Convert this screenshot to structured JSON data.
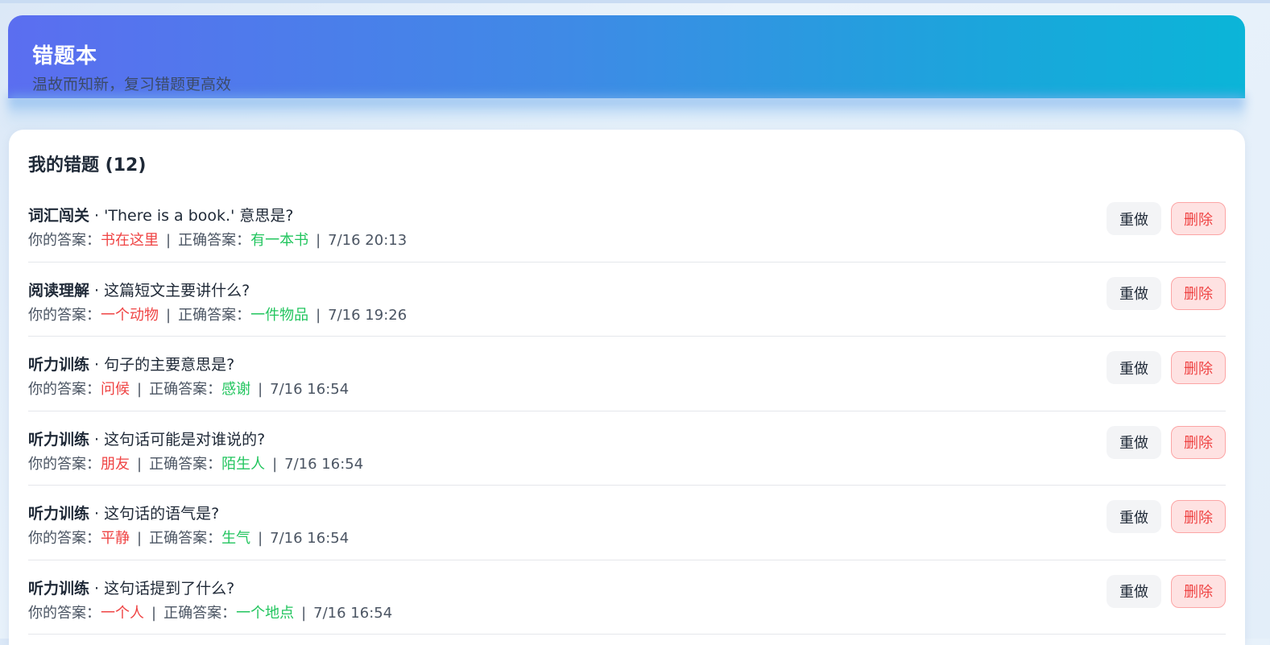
{
  "header": {
    "title": "错题本",
    "subtitle": "温故而知新，复习错题更高效"
  },
  "card": {
    "title": "我的错题 (12)"
  },
  "labels": {
    "your_answer": "你的答案：",
    "correct_answer": "正确答案：",
    "redo": "重做",
    "delete": "删除",
    "dot": " · ",
    "sep": "|"
  },
  "colors": {
    "wrong": "#ef4444",
    "right": "#22c55e",
    "header_start": "#5b6ef0",
    "header_end": "#0bb5d8"
  },
  "items": [
    {
      "category": "词汇闯关",
      "question": "'There is a book.' 意思是?",
      "your": "书在这里",
      "correct": "有一本书",
      "time": "7/16 20:13"
    },
    {
      "category": "阅读理解",
      "question": "这篇短文主要讲什么?",
      "your": "一个动物",
      "correct": "一件物品",
      "time": "7/16 19:26"
    },
    {
      "category": "听力训练",
      "question": "句子的主要意思是?",
      "your": "问候",
      "correct": "感谢",
      "time": "7/16 16:54"
    },
    {
      "category": "听力训练",
      "question": "这句话可能是对谁说的?",
      "your": "朋友",
      "correct": "陌生人",
      "time": "7/16 16:54"
    },
    {
      "category": "听力训练",
      "question": "这句话的语气是?",
      "your": "平静",
      "correct": "生气",
      "time": "7/16 16:54"
    },
    {
      "category": "听力训练",
      "question": "这句话提到了什么?",
      "your": "一个人",
      "correct": "一个地点",
      "time": "7/16 16:54"
    }
  ]
}
